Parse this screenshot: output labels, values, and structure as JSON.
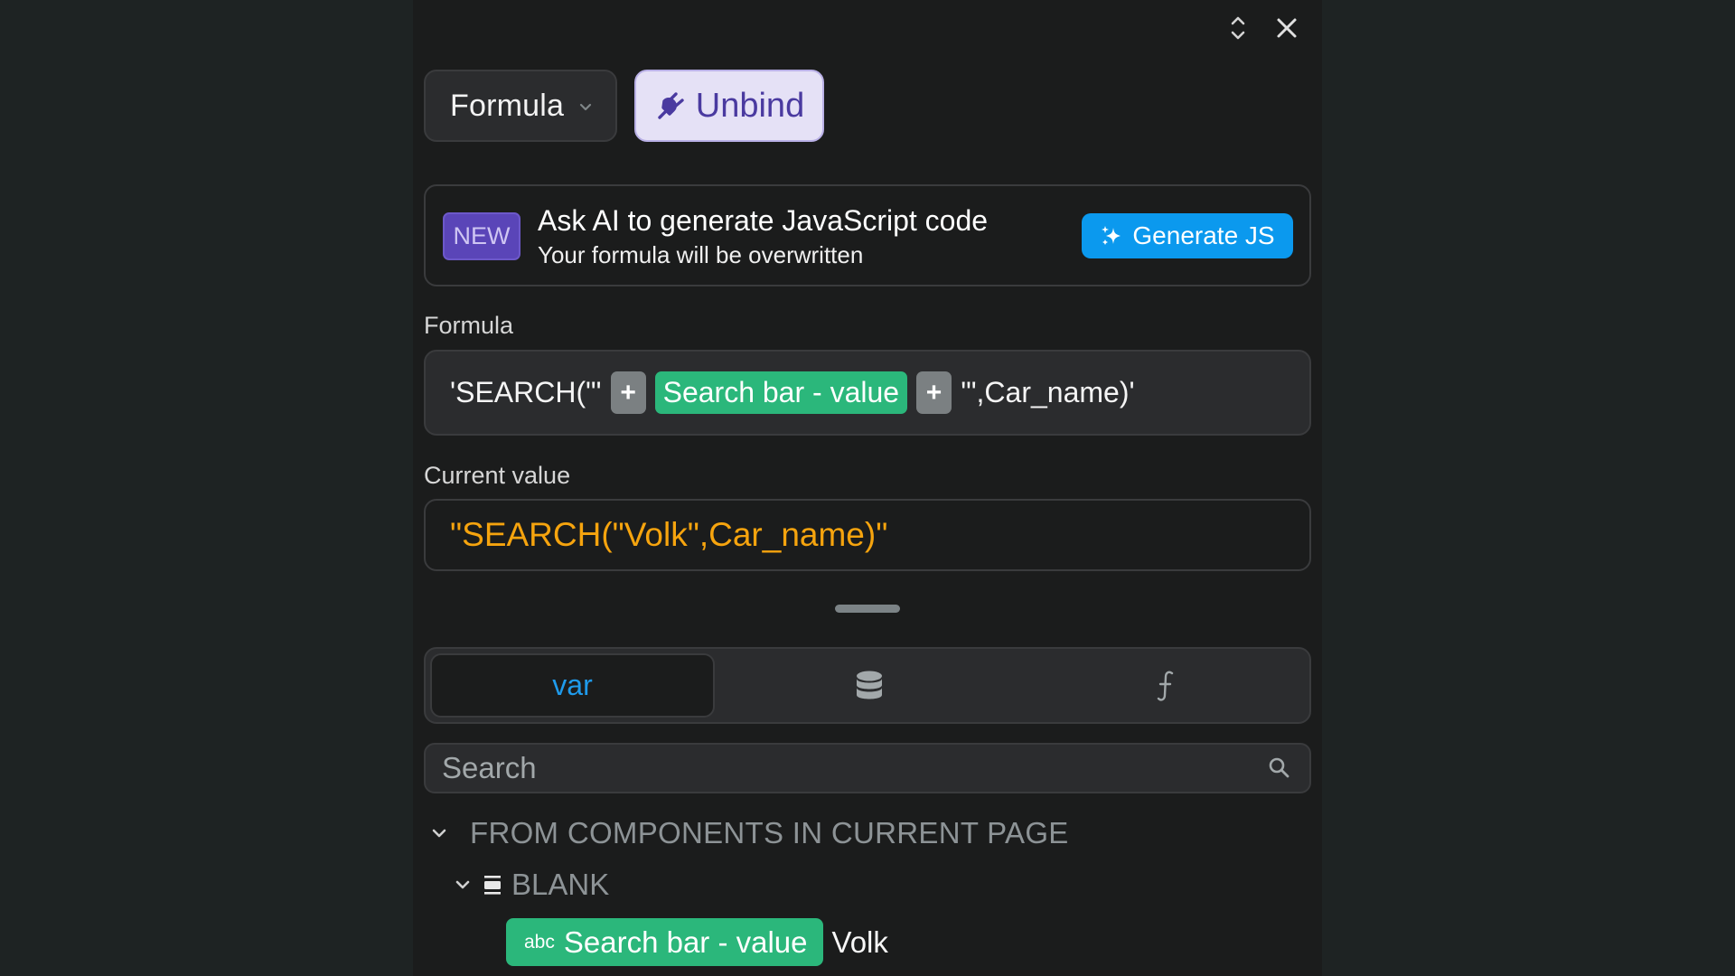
{
  "header": {
    "icons": [
      "expand-collapse-icon",
      "close-icon"
    ]
  },
  "binding": {
    "mode_label": "Formula",
    "unbind_label": "Unbind",
    "colors": {
      "unbind_bg": "#e5e1f6",
      "unbind_text": "#4a3aa0"
    }
  },
  "ai_banner": {
    "badge": "NEW",
    "title": "Ask AI to generate JavaScript code",
    "subtitle": "Your formula will be overwritten",
    "button_label": "Generate JS",
    "colors": {
      "badge_bg": "#5a45b8",
      "button_bg": "#0b99ee"
    }
  },
  "formula": {
    "label": "Formula",
    "tokens": [
      {
        "type": "text",
        "text": "'SEARCH(\"'"
      },
      {
        "type": "operator",
        "text": "+"
      },
      {
        "type": "variable",
        "text": "Search bar - value"
      },
      {
        "type": "operator",
        "text": "+"
      },
      {
        "type": "text",
        "text": "'\",Car_name)'"
      }
    ]
  },
  "current_value": {
    "label": "Current value",
    "value": "\"SEARCH(\"Volk\",Car_name)\"",
    "color": "#f6a40e"
  },
  "tabs": [
    {
      "id": "var",
      "label": "var",
      "active": true
    },
    {
      "id": "data",
      "icon": "database-icon",
      "active": false
    },
    {
      "id": "functions",
      "icon": "function-icon",
      "active": false
    }
  ],
  "search": {
    "placeholder": "Search",
    "value": ""
  },
  "tree": {
    "section": {
      "label": "FROM COMPONENTS IN CURRENT PAGE",
      "expanded": true
    },
    "group": {
      "label": "BLANK",
      "expanded": true
    },
    "items": [
      {
        "type_label": "abc",
        "name": "Search bar - value",
        "value": "Volk"
      }
    ],
    "colors": {
      "variable_chip": "#2bb77b"
    }
  }
}
